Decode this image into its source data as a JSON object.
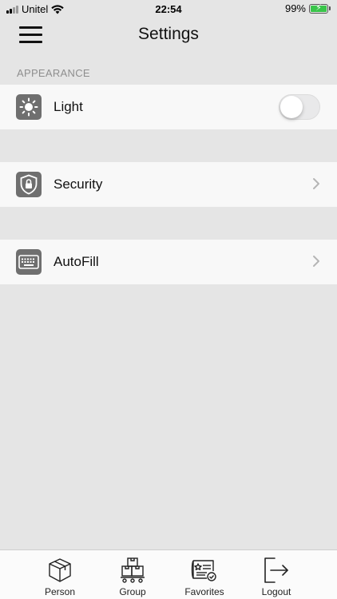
{
  "status_bar": {
    "carrier": "Unitel",
    "time": "22:54",
    "battery_percent": "99%",
    "battery_level": 0.99,
    "signal_bars": 2
  },
  "nav": {
    "title": "Settings"
  },
  "appearance": {
    "header": "APPEARANCE",
    "light_label": "Light",
    "light_enabled": false
  },
  "rows": {
    "security_label": "Security",
    "autofill_label": "AutoFill"
  },
  "tabs": [
    {
      "label": "Person",
      "icon": "box-icon"
    },
    {
      "label": "Group",
      "icon": "stacked-boxes-icon"
    },
    {
      "label": "Favorites",
      "icon": "certificate-icon"
    },
    {
      "label": "Logout",
      "icon": "logout-icon"
    }
  ],
  "colors": {
    "background": "#e5e5e5",
    "row_background": "#f8f8f8",
    "icon_tile": "#6f6f6f",
    "battery_green": "#39c54a"
  }
}
